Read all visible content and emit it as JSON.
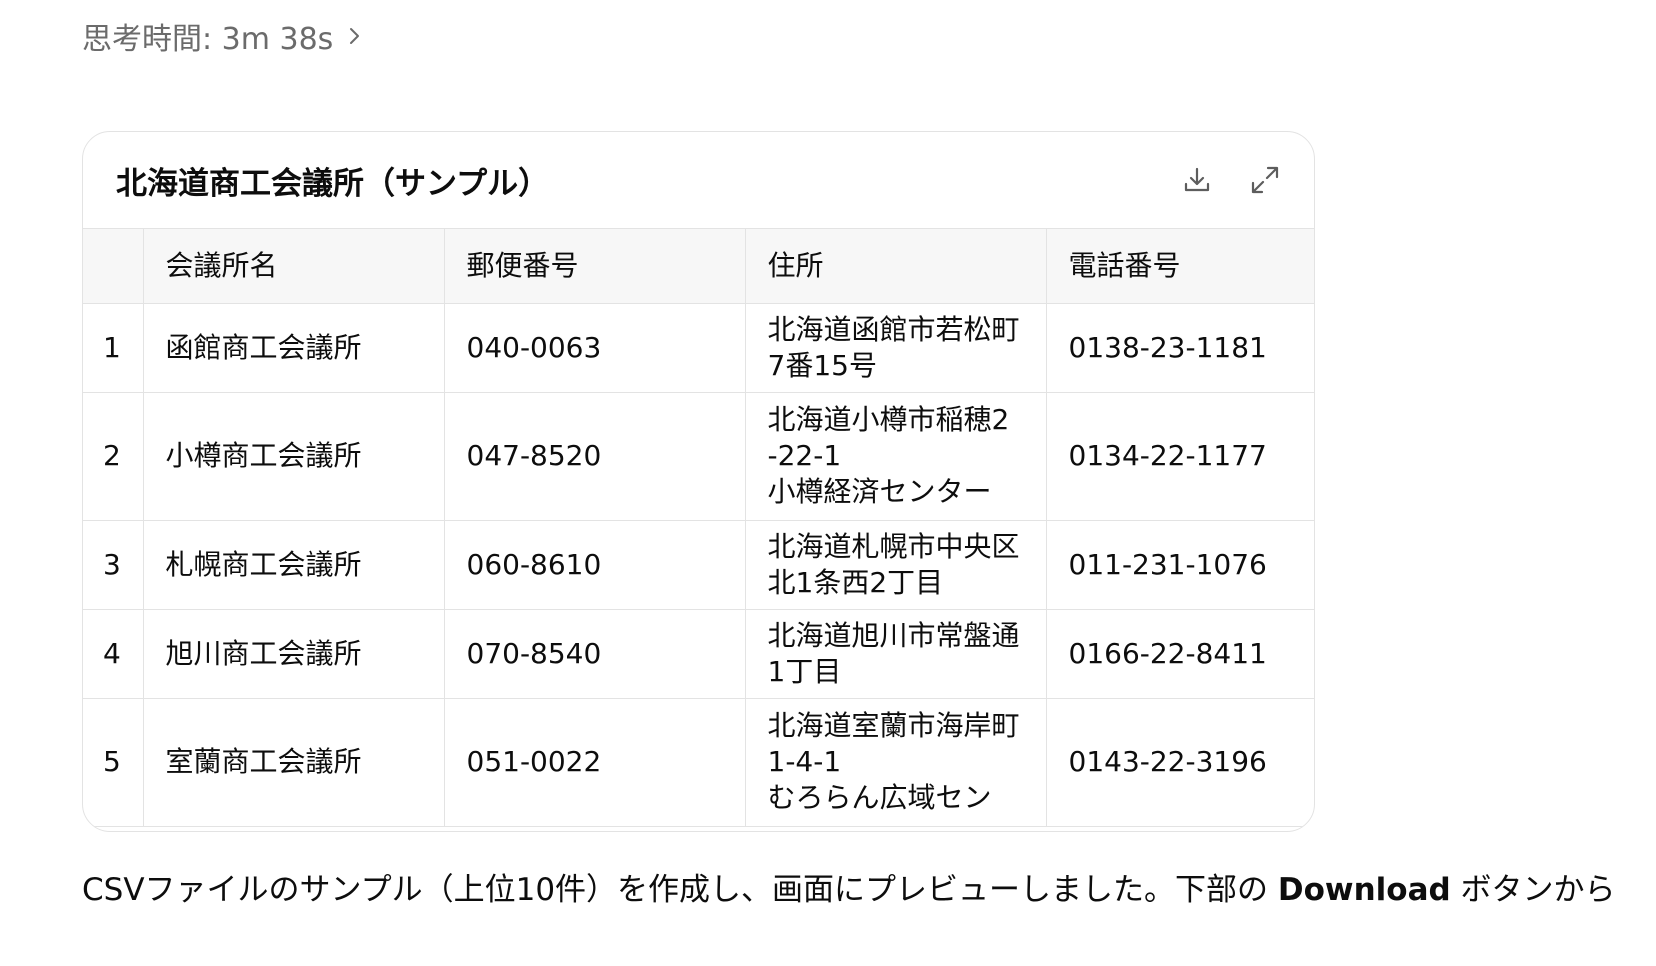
{
  "thinking": {
    "label": "思考時間: 3m 38s"
  },
  "card": {
    "title": "北海道商工会議所（サンプル）",
    "columns": [
      "",
      "会議所名",
      "郵便番号",
      "住所",
      "電話番号"
    ],
    "rows": [
      {
        "index": "1",
        "name": "函館商工会議所",
        "postal": "040-0063",
        "address": "北海道函館市若松町\n7番15号",
        "phone": "0138-23-1181"
      },
      {
        "index": "2",
        "name": "小樽商工会議所",
        "postal": "047-8520",
        "address": "北海道小樽市稲穂2\n-22-1\n小樽経済センター",
        "phone": "0134-22-1177"
      },
      {
        "index": "3",
        "name": "札幌商工会議所",
        "postal": "060-8610",
        "address": "北海道札幌市中央区\n北1条西2丁目",
        "phone": "011-231-1076"
      },
      {
        "index": "4",
        "name": "旭川商工会議所",
        "postal": "070-8540",
        "address": "北海道旭川市常盤通\n1丁目",
        "phone": "0166-22-8411"
      },
      {
        "index": "5",
        "name": "室蘭商工会議所",
        "postal": "051-0022",
        "address": "北海道室蘭市海岸町\n1-4-1\nむろらん広域セン",
        "phone": "0143-22-3196"
      }
    ]
  },
  "footer": {
    "text_before": "CSVファイルのサンプル（上位10件）を作成し、画面にプレビューしました。下部の ",
    "bold": "Download",
    "text_after": " ボタンから"
  },
  "icons": {
    "download": "download-icon",
    "expand": "expand-icon",
    "chevron": "chevron-right-icon"
  }
}
